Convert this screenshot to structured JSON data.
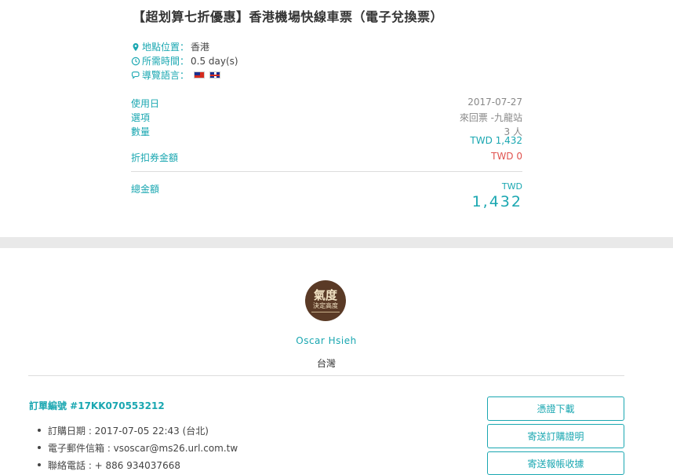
{
  "product": {
    "title": "【超划算七折優惠】香港機場快線車票（電子兌換票）",
    "location_label": "地點位置：",
    "location_value": "香港",
    "duration_label": "所需時間：",
    "duration_value": "0.5 day(s)",
    "language_label": "導覽語言：",
    "language_flags": [
      "flag-taiwan-icon",
      "flag-uk-icon"
    ]
  },
  "booking": {
    "date_label": "使用日",
    "date_value": "2017-07-27",
    "option_label": "選項",
    "option_value": "來回票 -九龍站",
    "qty_label": "數量",
    "qty_value": "3 人",
    "qty_price": "TWD 1,432",
    "discount_label": "折扣券金額",
    "discount_value": "TWD 0",
    "total_label": "總金額",
    "total_currency": "TWD",
    "total_amount": "1,432"
  },
  "user": {
    "avatar_text_1": "氣度",
    "avatar_text_2": "決定高度",
    "name": "Oscar Hsieh",
    "country": "台灣"
  },
  "order": {
    "number": "訂單編號 #17KK070553212",
    "details": [
      "訂購日期 : 2017-07-05 22:43 (台北)",
      "電子郵件信箱 : vsoscar@ms26.url.com.tw",
      "聯絡電話 : + 886 934037668"
    ]
  },
  "actions": {
    "download": "憑證下載",
    "send_proof": "寄送訂購證明",
    "send_receipt": "寄送報帳收據"
  },
  "colors": {
    "accent": "#1aa7b1",
    "danger": "#e0534f",
    "band": "#e9e9e9"
  }
}
